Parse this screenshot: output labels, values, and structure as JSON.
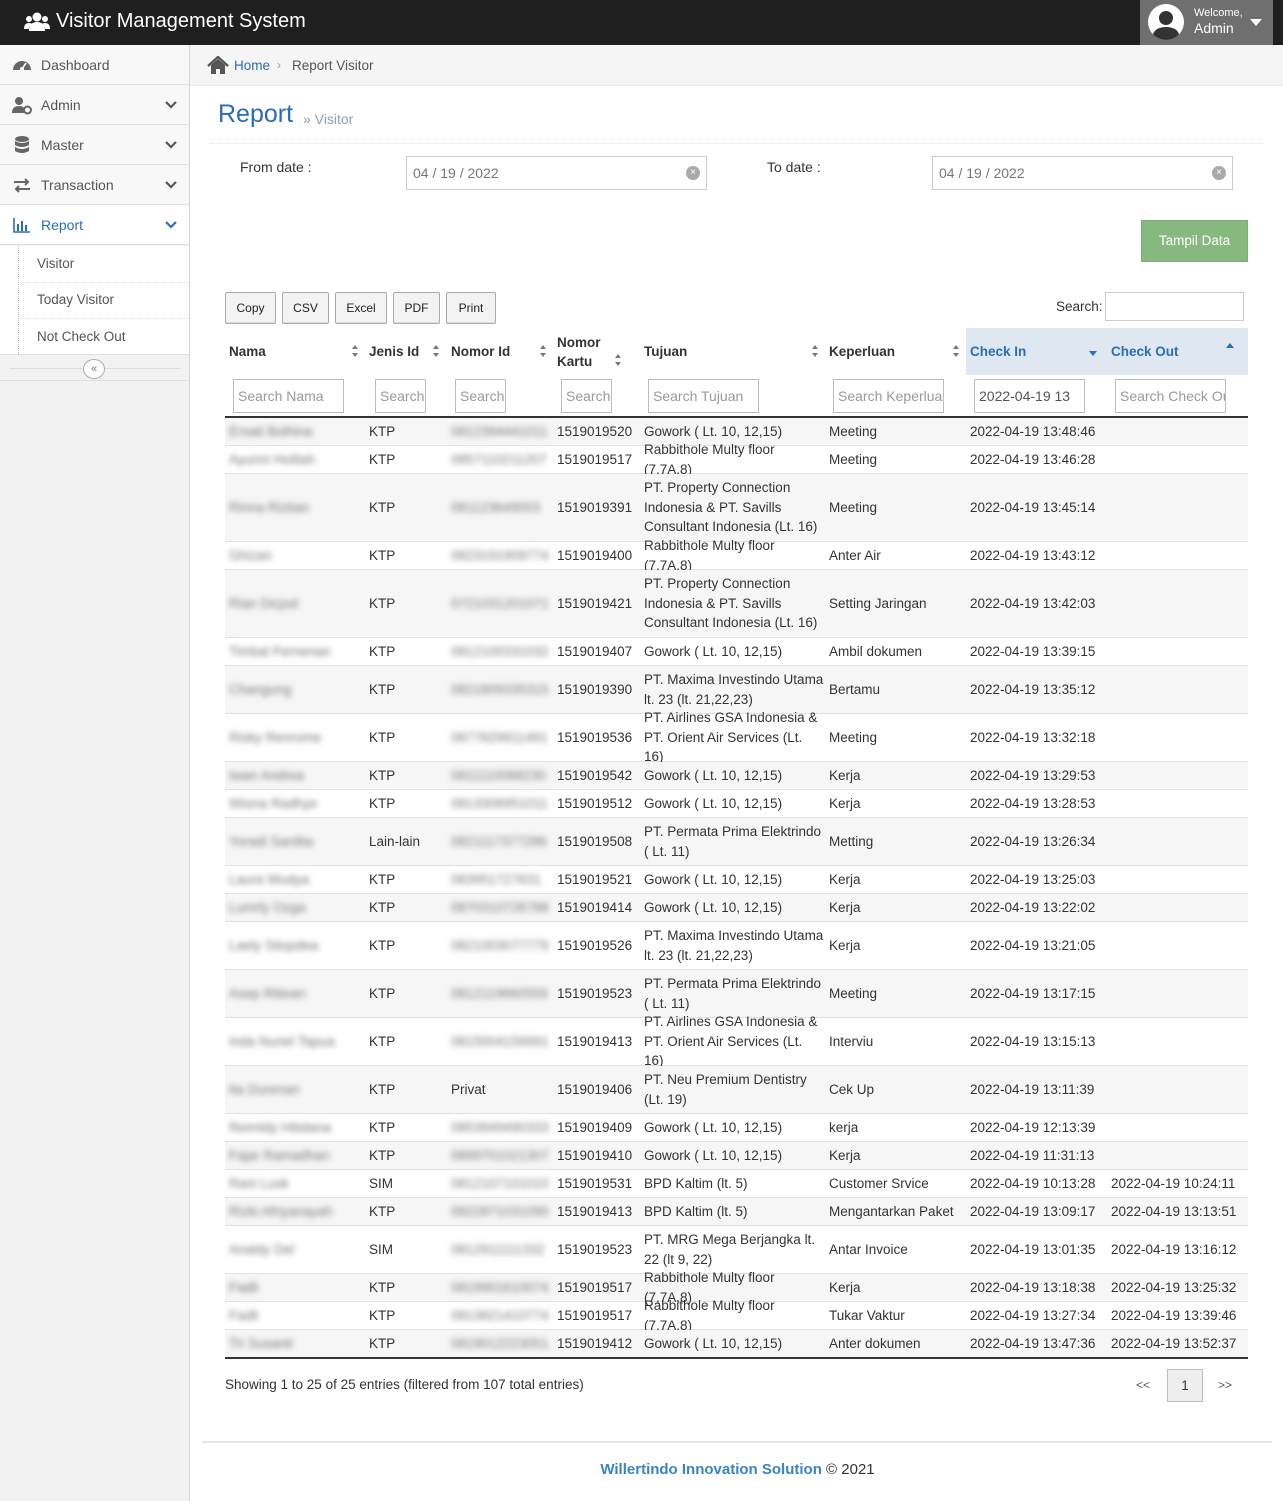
{
  "app": {
    "title": "Visitor Management System",
    "welcome": "Welcome,",
    "user": "Admin"
  },
  "sidebar": {
    "items": [
      {
        "label": "Dashboard",
        "icon": "dashboard-icon"
      },
      {
        "label": "Admin",
        "icon": "user-gear-icon"
      },
      {
        "label": "Master",
        "icon": "database-icon"
      },
      {
        "label": "Transaction",
        "icon": "exchange-icon"
      },
      {
        "label": "Report",
        "icon": "bar-chart-icon"
      }
    ],
    "submenu": [
      "Visitor",
      "Today Visitor",
      "Not Check Out"
    ],
    "collapse": "«"
  },
  "breadcrumb": {
    "home": "Home",
    "sep": "›",
    "current": "Report Visitor"
  },
  "page": {
    "title": "Report",
    "subtitle": "» Visitor"
  },
  "filters": {
    "from_label": "From date :",
    "from_value": "04 / 19 / 2022",
    "to_label": "To date :",
    "to_value": "04 / 19 / 2022",
    "clear": "×",
    "submit": "Tampil Data"
  },
  "toolbar": {
    "copy": "Copy",
    "csv": "CSV",
    "excel": "Excel",
    "pdf": "PDF",
    "print": "Print",
    "search_label": "Search:"
  },
  "table": {
    "columns": [
      "Nama",
      "Jenis Id",
      "Nomor Id",
      "Nomor Kartu",
      "Tujuan",
      "Keperluan",
      "Check In",
      "Check Out"
    ],
    "filters": [
      "Search Nama",
      "Search",
      "Search",
      "Search",
      "Search Tujuan",
      "Search Keperluan",
      "2022-04-19 13",
      "Search Check Out"
    ],
    "rows": [
      [
        "Ersati Bolhina",
        "KTP",
        "0812394441011",
        "1519019520",
        "Gowork ( Lt. 10, 12,15)",
        "Meeting",
        "2022-04-19 13:48:46",
        ""
      ],
      [
        "Ayunni Holilah",
        "KTP",
        "0857110211207",
        "1519019517",
        "Rabbithole Multy floor (7,7A,8)",
        "Meeting",
        "2022-04-19 13:46:28",
        ""
      ],
      [
        "Rinna Riztian",
        "KTP",
        "081123649003",
        "1519019391",
        "PT. Property Connection Indonesia & PT. Savills Consultant Indonesia (Lt. 16)",
        "Meeting",
        "2022-04-19 13:45:14",
        ""
      ],
      [
        "Ghizan",
        "KTP",
        "0823191909774",
        "1519019400",
        "Rabbithole Multy floor (7,7A,8)",
        "Anter Air",
        "2022-04-19 13:43:12",
        ""
      ],
      [
        "Rian Dicjod",
        "KTP",
        "0721031201071",
        "1519019421",
        "PT. Property Connection Indonesia & PT. Savills Consultant Indonesia (Lt. 16)",
        "Setting Jaringan",
        "2022-04-19 13:42:03",
        ""
      ],
      [
        "Timbal Fernenan",
        "KTP",
        "0812100331032",
        "1519019407",
        "Gowork ( Lt. 10, 12,15)",
        "Ambil dokumen",
        "2022-04-19 13:39:15",
        ""
      ],
      [
        "Changung",
        "KTP",
        "0821809335315",
        "1519019390",
        "PT. Maxima Investindo Utama lt. 23 (lt. 21,22,23)",
        "Bertamu",
        "2022-04-19 13:35:12",
        ""
      ],
      [
        "Risky Renrome",
        "KTP",
        "0877829911491",
        "1519019536",
        "PT. Airlines GSA Indonesia & PT. Orient Air Services (Lt. 16)",
        "Meeting",
        "2022-04-19 13:32:18",
        ""
      ],
      [
        "Iwan Andrea",
        "KTP",
        "0811110088230",
        "1519019542",
        "Gowork ( Lt. 10, 12,15)",
        "Kerja",
        "2022-04-19 13:29:53",
        ""
      ],
      [
        "Wiona Radhye",
        "KTP",
        "0813306951011",
        "1519019512",
        "Gowork ( Lt. 10, 12,15)",
        "Kerja",
        "2022-04-19 13:28:53",
        ""
      ],
      [
        "Yoradi Sardita",
        "Lain-lain",
        "0821117377286",
        "1519019508",
        "PT. Permata Prima Elektrindo ( Lt. 11)",
        "Metting",
        "2022-04-19 13:26:34",
        ""
      ],
      [
        "Laura Wudya",
        "KTP",
        "083951727631",
        "1519019521",
        "Gowork ( Lt. 10, 12,15)",
        "Kerja",
        "2022-04-19 13:25:03",
        ""
      ],
      [
        "Lumrly Ozga",
        "KTP",
        "0870310726788",
        "1519019414",
        "Gowork ( Lt. 10, 12,15)",
        "Kerja",
        "2022-04-19 13:22:02",
        ""
      ],
      [
        "Laely Sitopdea",
        "KTP",
        "0821003077779",
        "1519019526",
        "PT. Maxima Investindo Utama lt. 23 (lt. 21,22,23)",
        "Kerja",
        "2022-04-19 13:21:05",
        ""
      ],
      [
        "Asep Ritiean",
        "KTP",
        "0812119660559",
        "1519019523",
        "PT. Permata Prima Elektrindo ( Lt. 11)",
        "Meeting",
        "2022-04-19 13:17:15",
        ""
      ],
      [
        "Inda Nuriel Tapua",
        "KTP",
        "0815004159991",
        "1519019413",
        "PT. Airlines GSA Indonesia & PT. Orient Air Services (Lt. 16)",
        "Interviu",
        "2022-04-19 13:15:13",
        ""
      ],
      [
        "Ita Durenan",
        "KTP",
        "Privat",
        "1519019406",
        "PT. Neu Premium Dentistry (Lt. 19)",
        "Cek Up",
        "2022-04-19 13:11:39",
        ""
      ],
      [
        "Reimldy Hitidana",
        "KTP",
        "0853949490333",
        "1519019409",
        "Gowork ( Lt. 10, 12,15)",
        "kerja",
        "2022-04-19 12:13:39",
        ""
      ],
      [
        "Fajar Ramadhan",
        "KTP",
        "0899701021307",
        "1519019410",
        "Gowork ( Lt. 10, 12,15)",
        "Kerja",
        "2022-04-19 11:31:13",
        ""
      ],
      [
        "Rani Lusk",
        "SIM",
        "0812107101010",
        "1519019531",
        "BPD Kaltim (lt. 5)",
        "Customer Srvice",
        "2022-04-19 10:13:28",
        "2022-04-19 10:24:11"
      ],
      [
        "Rizki Afriyanayah",
        "KTP",
        "0822871031090",
        "1519019413",
        "BPD Kaltim (lt. 5)",
        "Mengantarkan Paket",
        "2022-04-19 13:09:17",
        "2022-04-19 13:13:51"
      ],
      [
        "Analdy Del",
        "SIM",
        "0812911111332",
        "1519019523",
        "PT. MRG Mega Berjangka lt. 22 (lt 9, 22)",
        "Antar Invoice",
        "2022-04-19 13:01:35",
        "2022-04-19 13:16:12"
      ],
      [
        "Fadli",
        "KTP",
        "0819901610074",
        "1519019517",
        "Rabbithole Multy floor (7,7A,8)",
        "Kerja",
        "2022-04-19 13:18:38",
        "2022-04-19 13:25:32"
      ],
      [
        "Fadli",
        "KTP",
        "0813821410774",
        "1519019517",
        "Rabbithole Multy floor (7,7A,8)",
        "Tukar Vaktur",
        "2022-04-19 13:27:34",
        "2022-04-19 13:39:46"
      ],
      [
        "Tri Susanti",
        "KTP",
        "0819012223051",
        "1519019412",
        "Gowork ( Lt. 10, 12,15)",
        "Anter dokumen",
        "2022-04-19 13:47:36",
        "2022-04-19 13:52:37"
      ]
    ]
  },
  "pagination": {
    "info": "Showing 1 to 25 of 25 entries (filtered from 107 total entries)",
    "prev": "<<",
    "current": "1",
    "next": ">>"
  },
  "footer": {
    "company": "Willertindo Innovation Solution",
    "copyright": "© 2021"
  }
}
